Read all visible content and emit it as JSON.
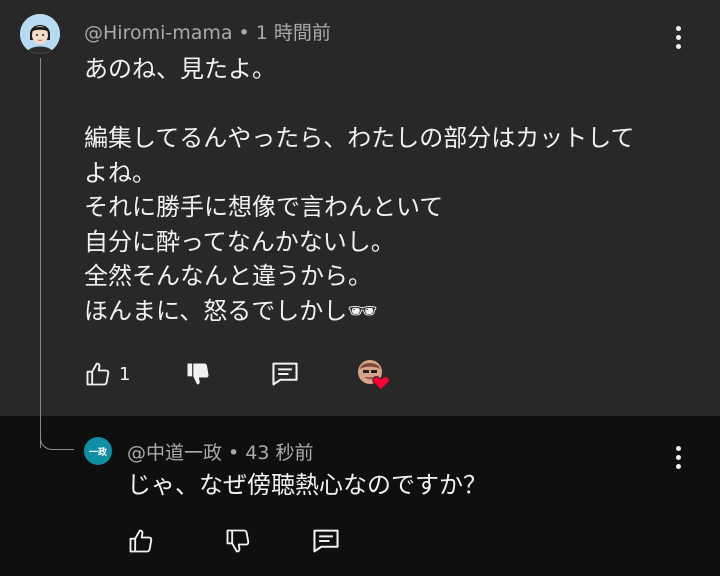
{
  "comment": {
    "author": "@Hiromi-mama",
    "separator": "•",
    "time": "1 時間前",
    "lines": [
      "あのね、見たよ。",
      "",
      "編集してるんやったら、わたしの部分はカットして",
      "よね。",
      "それに勝手に想像で言わんといて",
      "自分に酔ってなんかないし。",
      "全然そんなんと違うから。",
      "ほんまに、怒るでしかし🕶"
    ],
    "like_count": "1",
    "icons": {
      "like": "thumbs-up-icon",
      "dislike": "thumbs-down-filled-icon",
      "reply": "reply-comment-icon",
      "heart": "creator-heart-icon",
      "more": "more-vertical-icon"
    }
  },
  "reply": {
    "author": "@中道一政",
    "separator": "•",
    "time": "43 秒前",
    "avatar_text": "一政",
    "text": "じゃ、なぜ傍聴熱心なのですか？",
    "icons": {
      "like": "thumbs-up-icon",
      "dislike": "thumbs-down-icon",
      "reply": "reply-comment-icon",
      "more": "more-vertical-icon"
    }
  },
  "colors": {
    "top_background": "#282828",
    "bottom_background": "#0f0f0f",
    "heart": "#ff0033",
    "avatar_reply": "#0f8fa4"
  }
}
